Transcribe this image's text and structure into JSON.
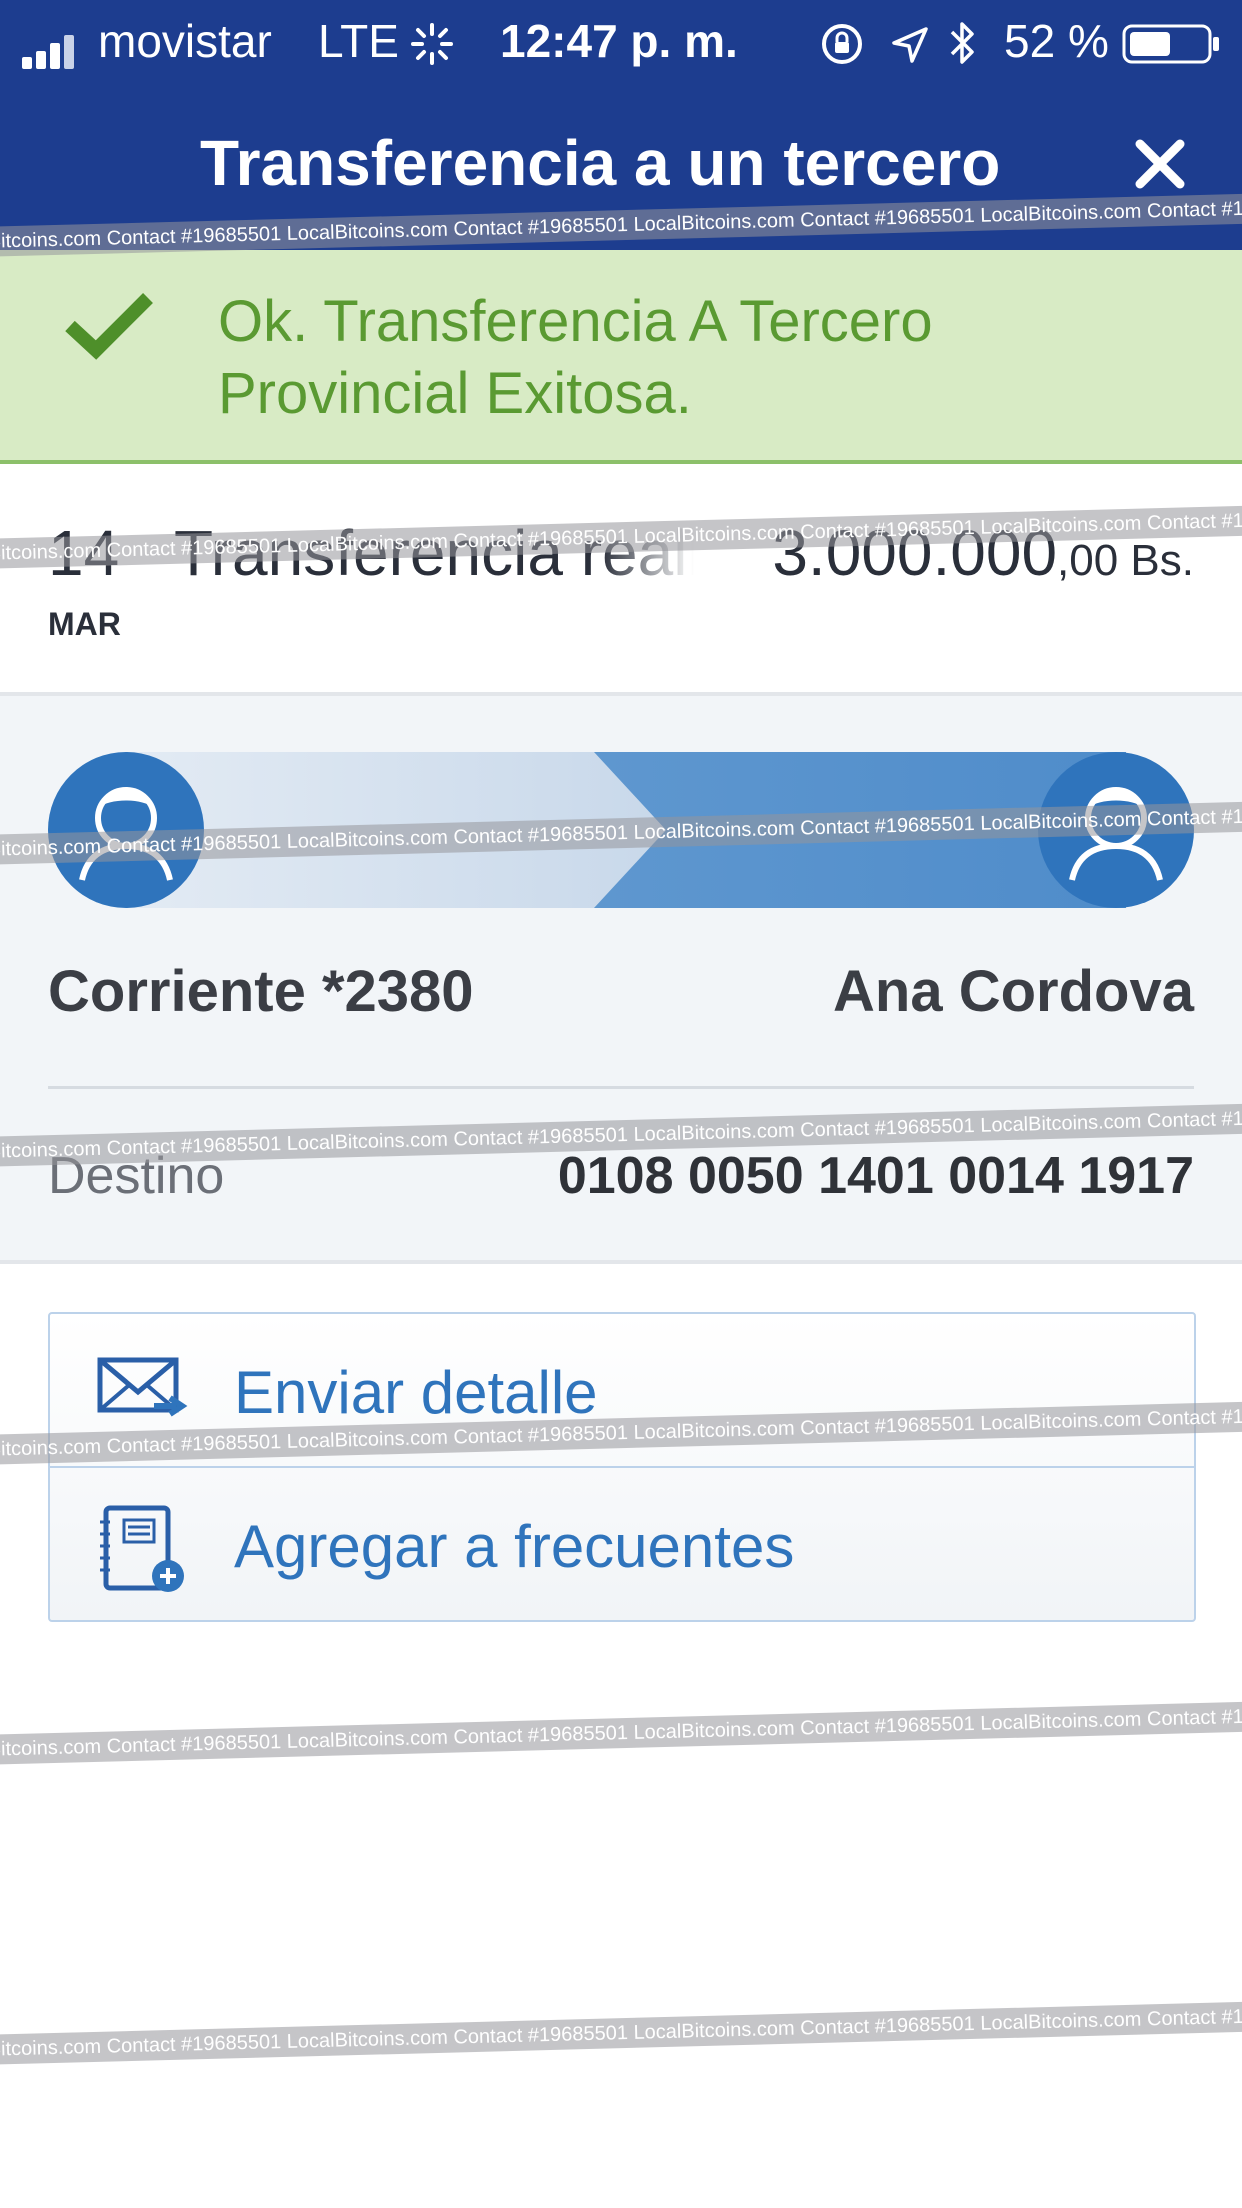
{
  "status_bar": {
    "carrier": "movistar",
    "network": "LTE",
    "time": "12:47 p. m.",
    "battery_percent": "52 %"
  },
  "header": {
    "title": "Transferencia a un tercero",
    "close_icon": "close-icon"
  },
  "banner": {
    "message_line1": "Ok. Transferencia A Tercero",
    "message_line2": "Provincial Exitosa.",
    "color": "#5a9a32"
  },
  "transaction": {
    "day": "14",
    "month": "MAR",
    "description": "Transferencia realizada",
    "amount_main": "3.000.000",
    "amount_cents": ",00 Bs."
  },
  "transfer": {
    "from_account": "Corriente *2380",
    "to_name": "Ana Cordova",
    "destination_label": "Destino",
    "destination_value": "0108 0050 1401 0014 1917"
  },
  "actions": [
    {
      "label": "Enviar detalle",
      "icon": "mail-send-icon"
    },
    {
      "label": "Agregar a frecuentes",
      "icon": "address-book-add-icon"
    }
  ],
  "watermark": {
    "text": "LocalBitcoins.com Contact #19685501"
  },
  "colors": {
    "nav": "#1d3d8f",
    "accent": "#2f74bc",
    "banner_bg": "#d8ebc5"
  }
}
